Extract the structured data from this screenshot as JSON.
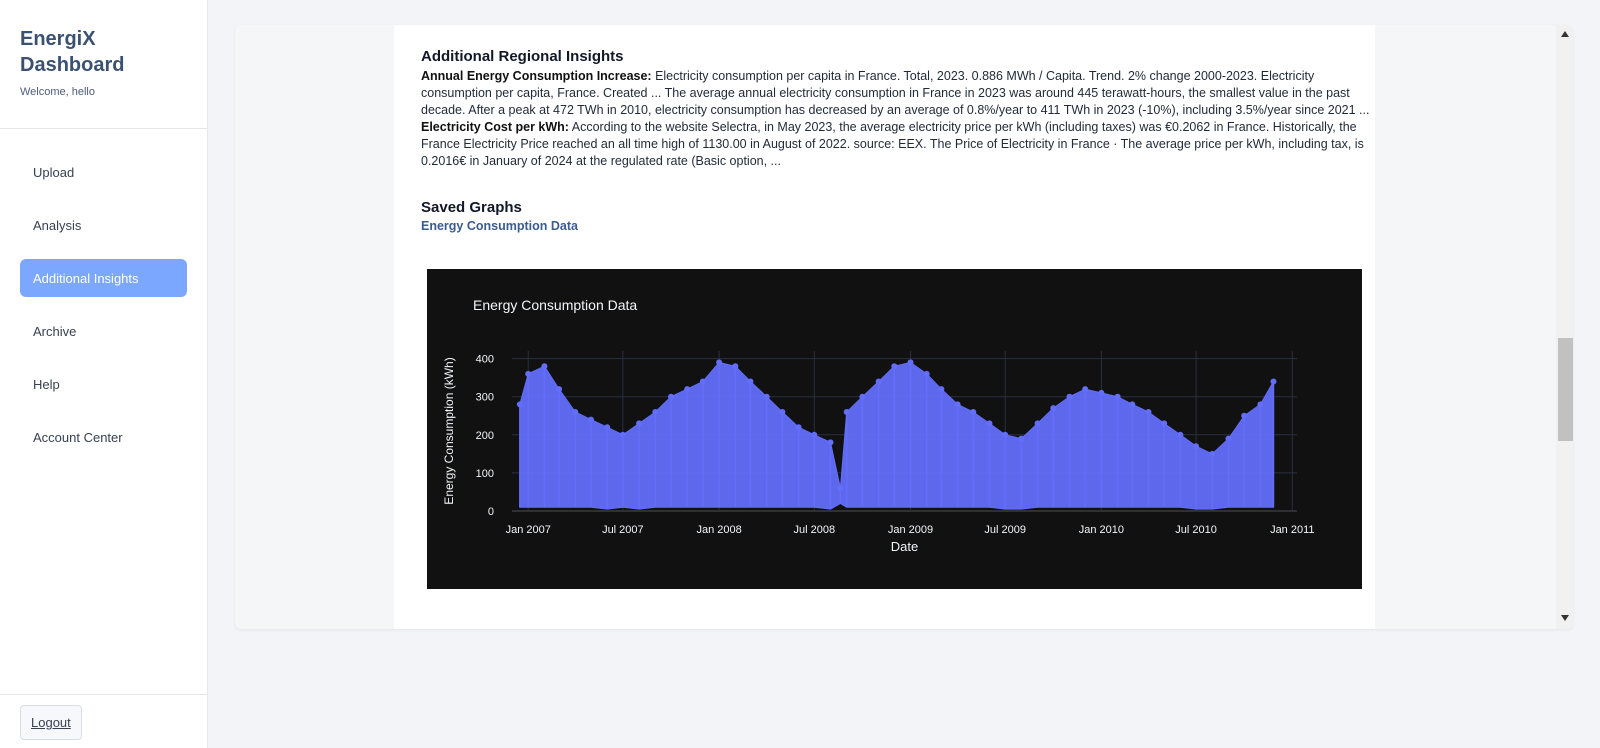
{
  "sidebar": {
    "brand_title": "EnergiX Dashboard",
    "welcome": "Welcome, hello",
    "items": [
      {
        "label": "Upload",
        "active": false
      },
      {
        "label": "Analysis",
        "active": false
      },
      {
        "label": "Additional Insights",
        "active": true
      },
      {
        "label": "Archive",
        "active": false
      },
      {
        "label": "Help",
        "active": false
      },
      {
        "label": "Account Center",
        "active": false
      }
    ],
    "logout_label": "Logout",
    "accent_color": "#7ba7ff"
  },
  "insights": {
    "title": "Additional Regional Insights",
    "consumption_label": "Annual Energy Consumption Increase:",
    "consumption_text": " Electricity consumption per capita in France. Total, 2023. 0.886 MWh / Capita. Trend. 2% change 2000-2023. Electricity consumption per capita, France. Created ... The average annual electricity consumption in France in 2023 was around 445 terawatt-hours, the smallest value in the past decade. After a peak at 472 TWh in 2010, electricity consumption has decreased by an average of 0.8%/year to 411 TWh in 2023 (-10%), including 3.5%/year since 2021 ...",
    "cost_label": "Electricity Cost per kWh:",
    "cost_text": " According to the website Selectra, in May 2023, the average electricity price per kWh (including taxes) was €0.2062 in France. Historically, the France Electricity Price reached an all time high of 1130.00 in August of 2022. source: EEX. The Price of Electricity in France · The average price per kWh, including tax, is 0.2016€ in January of 2024 at the regulated rate (Basic option, ..."
  },
  "saved_graphs": {
    "title": "Saved Graphs",
    "graph_name": "Energy Consumption Data"
  },
  "chart_data": {
    "type": "scatter",
    "title": "Energy Consumption Data",
    "xlabel": "Date",
    "ylabel": "Energy Consumption (kWh)",
    "ylim": [
      0,
      420
    ],
    "yticks": [
      0,
      100,
      200,
      300,
      400
    ],
    "xticks": [
      "Jan 2007",
      "Jul 2007",
      "Jan 2008",
      "Jul 2008",
      "Jan 2009",
      "Jul 2009",
      "Jan 2010",
      "Jul 2010",
      "Jan 2011"
    ],
    "xlim": [
      "2006-12-01",
      "2011-01-10"
    ],
    "grid": true,
    "background": "#111111",
    "marker_color": "#636efa",
    "series": [
      {
        "x": [
          "2006-12-16",
          "2007-01-01",
          "2007-02-01",
          "2007-03-01",
          "2007-04-01",
          "2007-05-01",
          "2007-06-01",
          "2007-07-01",
          "2007-08-01",
          "2007-09-01",
          "2007-10-01",
          "2007-11-01",
          "2007-12-01",
          "2008-01-01",
          "2008-02-01",
          "2008-03-01",
          "2008-04-01",
          "2008-05-01",
          "2008-06-01",
          "2008-07-01",
          "2008-08-01",
          "2008-08-20",
          "2008-09-01",
          "2008-10-01",
          "2008-11-01",
          "2008-12-01",
          "2009-01-01",
          "2009-02-01",
          "2009-03-01",
          "2009-04-01",
          "2009-05-01",
          "2009-06-01",
          "2009-07-01",
          "2009-08-01",
          "2009-09-01",
          "2009-10-01",
          "2009-11-01",
          "2009-12-01",
          "2010-01-01",
          "2010-02-01",
          "2010-03-01",
          "2010-04-01",
          "2010-05-01",
          "2010-06-01",
          "2010-07-01",
          "2010-08-01",
          "2010-09-01",
          "2010-10-01",
          "2010-11-01",
          "2010-11-26"
        ],
        "y_max": [
          280,
          360,
          380,
          320,
          260,
          240,
          220,
          200,
          230,
          260,
          300,
          320,
          340,
          390,
          380,
          340,
          300,
          260,
          220,
          200,
          180,
          60,
          260,
          300,
          340,
          380,
          390,
          360,
          320,
          280,
          260,
          230,
          200,
          190,
          230,
          270,
          300,
          320,
          310,
          300,
          280,
          260,
          230,
          200,
          170,
          150,
          190,
          250,
          280,
          340
        ],
        "y_min": [
          10,
          10,
          10,
          10,
          10,
          10,
          5,
          10,
          5,
          10,
          10,
          10,
          10,
          10,
          10,
          10,
          10,
          10,
          10,
          10,
          5,
          20,
          10,
          10,
          10,
          10,
          10,
          10,
          10,
          10,
          10,
          10,
          5,
          5,
          10,
          10,
          10,
          10,
          10,
          10,
          10,
          10,
          10,
          10,
          5,
          5,
          10,
          10,
          10,
          10
        ]
      }
    ]
  }
}
